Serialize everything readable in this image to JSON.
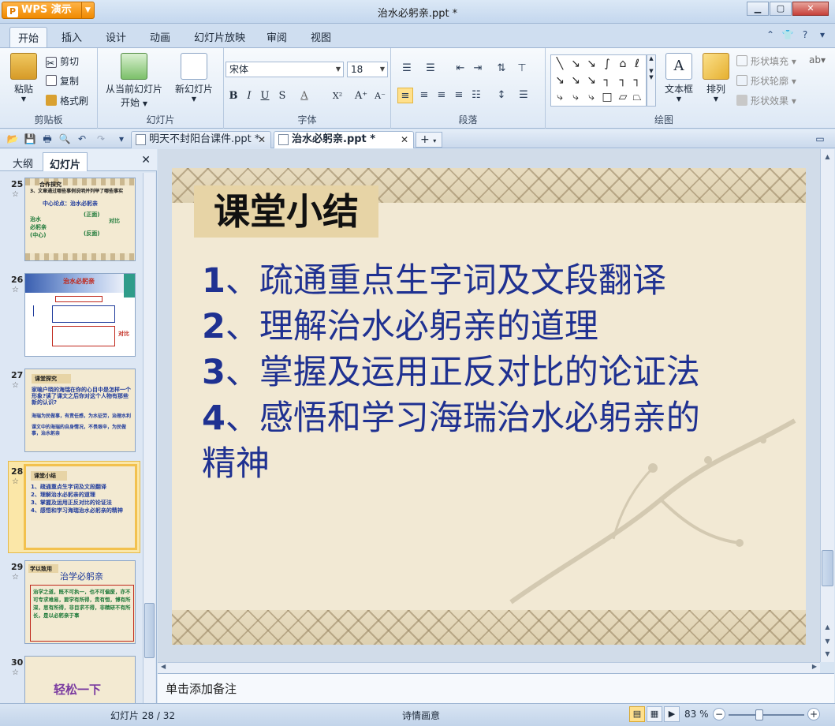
{
  "window": {
    "app_button": "WPS 演示",
    "title": "治水必躬亲.ppt *"
  },
  "ribbon_tabs": [
    "开始",
    "插入",
    "设计",
    "动画",
    "幻灯片放映",
    "审阅",
    "视图"
  ],
  "ribbon": {
    "clipboard": {
      "label": "剪贴板",
      "paste": "粘贴",
      "cut": "剪切",
      "copy": "复制",
      "format_painter": "格式刷"
    },
    "slides": {
      "label": "幻灯片",
      "from_current": "从当前幻灯片",
      "from_current_2": "开始",
      "new_slide": "新幻灯片"
    },
    "font": {
      "label": "字体",
      "family": "宋体",
      "size": "18"
    },
    "paragraph": {
      "label": "段落"
    },
    "drawing": {
      "label": "绘图",
      "textbox": "文本框",
      "arrange": "排列",
      "shape_fill": "形状填充",
      "shape_outline": "形状轮廓",
      "shape_effect": "形状效果"
    }
  },
  "doc_tabs": [
    {
      "name": "明天不封阳台课件.ppt *",
      "active": false
    },
    {
      "name": "治水必躬亲.ppt *",
      "active": true
    }
  ],
  "left_pane": {
    "tabs": [
      "大纲",
      "幻灯片"
    ],
    "slides": [
      {
        "num": "25",
        "lines": [
          "合作探究",
          "3、文章通过哪些事例说明并列举了哪些事实",
          "中心论点：治水必躬亲",
          "治水",
          "必躬亲",
          "(中心)",
          "(正面)",
          "(反面)",
          "对比"
        ]
      },
      {
        "num": "26",
        "lines": [
          "治水必躬亲"
        ]
      },
      {
        "num": "27",
        "title": "课堂探究",
        "lines": [
          "家喻户晓的海瑞在你的心目中是怎样一个形象?读了课文之后你对这个人物有那些新的认识?",
          "海瑞为民做事，有责任感，为水征劳，治理水利",
          "课文中的海瑞的自身情况，不畏艰辛，为民做事，治水躬亲"
        ]
      },
      {
        "num": "28",
        "title": "课堂小结",
        "lines": [
          "1、疏通重点生字词及文段翻译",
          "2、理解治水必躬亲的道理",
          "3、掌握及运用正反对比的论证法",
          "4、感悟和学习海瑞治水必躬亲的精神"
        ]
      },
      {
        "num": "29",
        "title": "学以致用",
        "heading": "治学必躬亲",
        "lines": [
          "治学之道，既不可执一，也不可偏废，亦不可专求难易，要学有所得，贵有恒，博有所深，思有所得，非目求不得，非精研不有所长，是以必躬亲于事"
        ]
      },
      {
        "num": "30",
        "heading": "轻松一下"
      }
    ]
  },
  "slide": {
    "title": "课堂小结",
    "points": [
      {
        "num": "1",
        "text": "、疏通重点生字词及文段翻译"
      },
      {
        "num": "2",
        "text": "、理解治水必躬亲的道理"
      },
      {
        "num": "3",
        "text": "、掌握及运用正反对比的论证法"
      },
      {
        "num": "4",
        "text": "、感悟和学习海瑞治水必躬亲的"
      }
    ],
    "continuation": "精神"
  },
  "notes_placeholder": "单击添加备注",
  "status": {
    "slide_counter": "幻灯片 28 / 32",
    "theme": "诗情画意",
    "zoom": "83 %",
    "zoom_value": 83
  }
}
